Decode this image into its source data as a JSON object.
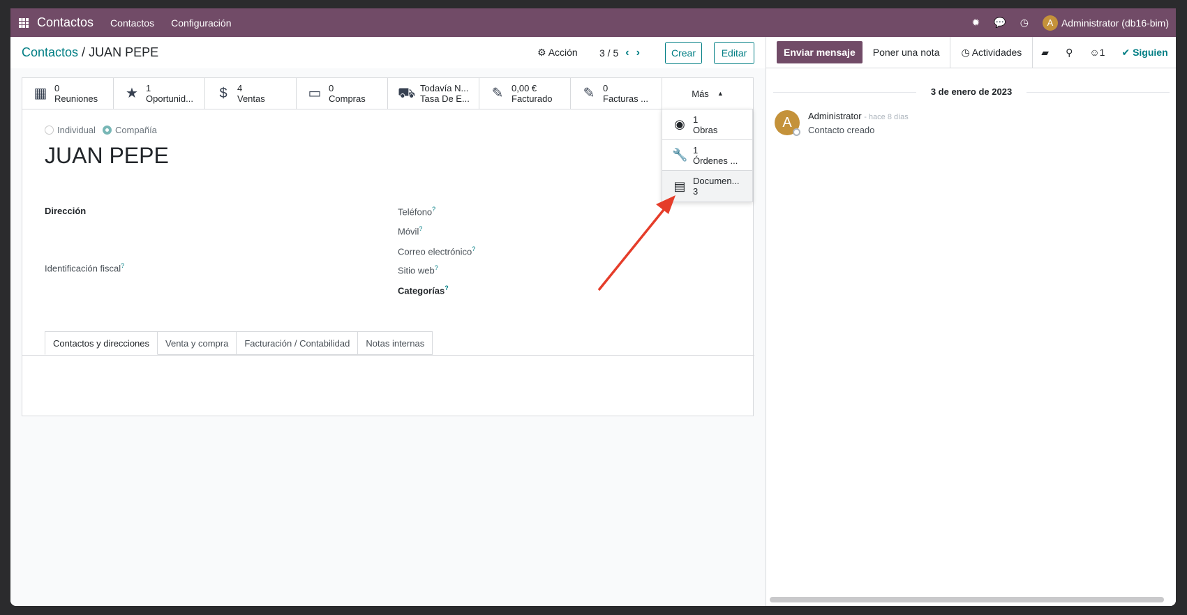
{
  "navbar": {
    "brand": "Contactos",
    "menu": [
      "Contactos",
      "Configuración"
    ],
    "user": "Administrator (db16-bim)",
    "user_initial": "A",
    "icons": [
      "bug-icon",
      "chat-icon",
      "clock-icon"
    ]
  },
  "control": {
    "breadcrumb_parent": "Contactos",
    "breadcrumb_sep": " / ",
    "breadcrumb_current": "JUAN PEPE",
    "action_label": "Acción",
    "pager": "3 / 5",
    "create_label": "Crear",
    "edit_label": "Editar"
  },
  "stat_buttons": [
    {
      "value": "0",
      "label": "Reuniones",
      "icon": "calendar-icon"
    },
    {
      "value": "1",
      "label": "Oportunid...",
      "icon": "star-icon"
    },
    {
      "value": "4",
      "label": "Ventas",
      "icon": "dollar-icon"
    },
    {
      "value": "0",
      "label": "Compras",
      "icon": "credit-card-icon"
    },
    {
      "value": "Todavía N...",
      "label": "Tasa De E...",
      "icon": "truck-icon"
    },
    {
      "value": "0,00 €",
      "label": "Facturado",
      "icon": "edit-icon"
    },
    {
      "value": "0",
      "label": "Facturas ...",
      "icon": "edit-icon"
    }
  ],
  "more_label": "Más",
  "dropdown_items": [
    {
      "value": "1",
      "label": "Obras",
      "icon": "compass-icon"
    },
    {
      "value": "1",
      "label": "Órdenes ...",
      "icon": "wrench-icon"
    },
    {
      "value": "3",
      "label": "Documen...",
      "icon": "document-icon"
    }
  ],
  "form": {
    "radio_individual": "Individual",
    "radio_company": "Compañía",
    "name": "JUAN PEPE",
    "address_label": "Dirección",
    "tax_id_label": "Identificación fiscal",
    "phone_label": "Teléfono",
    "mobile_label": "Móvil",
    "email_label": "Correo electrónico",
    "website_label": "Sitio web",
    "tags_label": "Categorías",
    "help_mark": "?"
  },
  "tabs": [
    "Contactos y direcciones",
    "Venta y compra",
    "Facturación / Contabilidad",
    "Notas internas"
  ],
  "chatter": {
    "send_message": "Enviar mensaje",
    "log_note": "Poner una nota",
    "activities": "Actividades",
    "followers_count": "1",
    "follow": "Siguien",
    "date": "3 de enero de 2023",
    "author": "Administrator",
    "time": "- hace 8 días",
    "body": "Contacto creado",
    "author_initial": "A"
  },
  "colors": {
    "brand": "#714b67",
    "accent": "#017e84",
    "annotation_arrow": "#e53d2a"
  }
}
